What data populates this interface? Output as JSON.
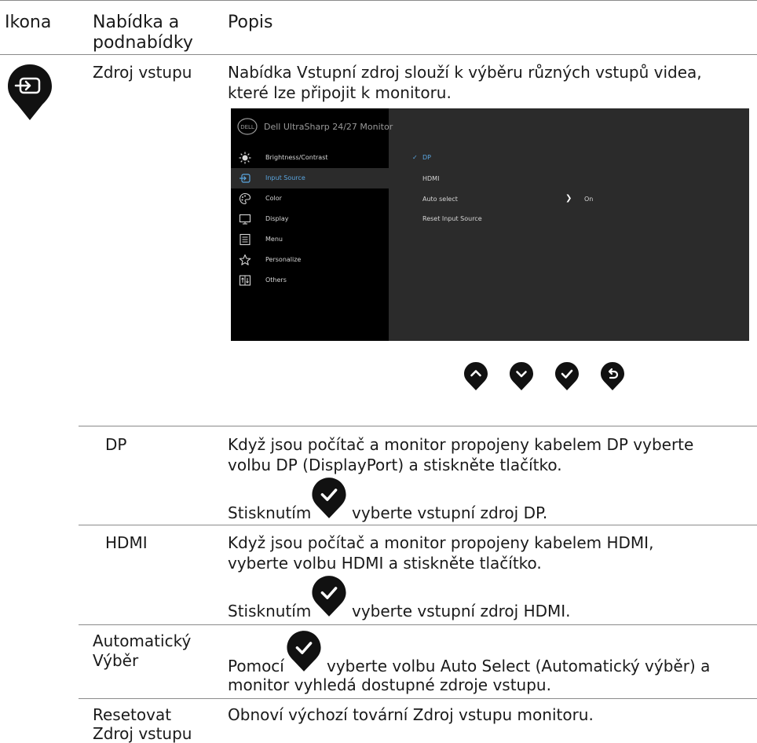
{
  "header": {
    "col_icon": "Ikona",
    "col_menu_line1": "Nabídka a",
    "col_menu_line2": "podnabídky",
    "col_desc": "Popis"
  },
  "main_row": {
    "icon": "input-source-icon",
    "menu_label": "Zdroj vstupu",
    "description_line1": "Nabídka Vstupní zdroj slouží k výběru různých vstupů videa,",
    "description_line2": "které lze připojit k monitoru."
  },
  "osd": {
    "brand": "DELL",
    "title": "Dell UltraSharp 24/27 Monitor",
    "menu": [
      {
        "label": "Brightness/Contrast",
        "icon": "brightness-icon"
      },
      {
        "label": "Input Source",
        "icon": "input-source-icon"
      },
      {
        "label": "Color",
        "icon": "color-palette-icon"
      },
      {
        "label": "Display",
        "icon": "display-icon"
      },
      {
        "label": "Menu",
        "icon": "menu-list-icon"
      },
      {
        "label": "Personalize",
        "icon": "star-icon"
      },
      {
        "label": "Others",
        "icon": "others-icon"
      }
    ],
    "active_menu": "Input Source",
    "options": [
      {
        "label": "DP",
        "selected": true
      },
      {
        "label": "HDMI",
        "selected": false
      },
      {
        "label": "Auto select",
        "value": "On"
      },
      {
        "label": "Reset Input Source"
      }
    ],
    "check_mark": "✓",
    "arrow": "❯",
    "accent_color": "#5aa6e0"
  },
  "nav_buttons": [
    "up-icon",
    "down-icon",
    "check-icon",
    "back-icon"
  ],
  "sub_rows": [
    {
      "name": "DP",
      "desc_line1": "Když jsou počítač a monitor propojeny kabelem DP vyberte",
      "desc_line2": "volbu DP (DisplayPort) a stiskněte tlačítko.",
      "press_pre": "Stisknutím",
      "press_post": "vyberte vstupní zdroj DP."
    },
    {
      "name": "HDMI",
      "desc_line1": "Když jsou počítač a monitor propojeny kabelem HDMI,",
      "desc_line2": "vyberte volbu HDMI a stiskněte tlačítko.",
      "press_pre": "Stisknutím",
      "press_post": "vyberte vstupní zdroj HDMI."
    },
    {
      "name_line1": "Automatický",
      "name_line2": "Výběr",
      "press_pre": "Pomocí",
      "press_post": "vyberte volbu Auto Select (Automatický výběr) a",
      "desc_line2": "monitor vyhledá dostupné zdroje vstupu."
    },
    {
      "name_line1": "Resetovat",
      "name_line2": "Zdroj vstupu",
      "desc_line1": "Obnoví výchozí tovární Zdroj vstupu monitoru."
    }
  ]
}
